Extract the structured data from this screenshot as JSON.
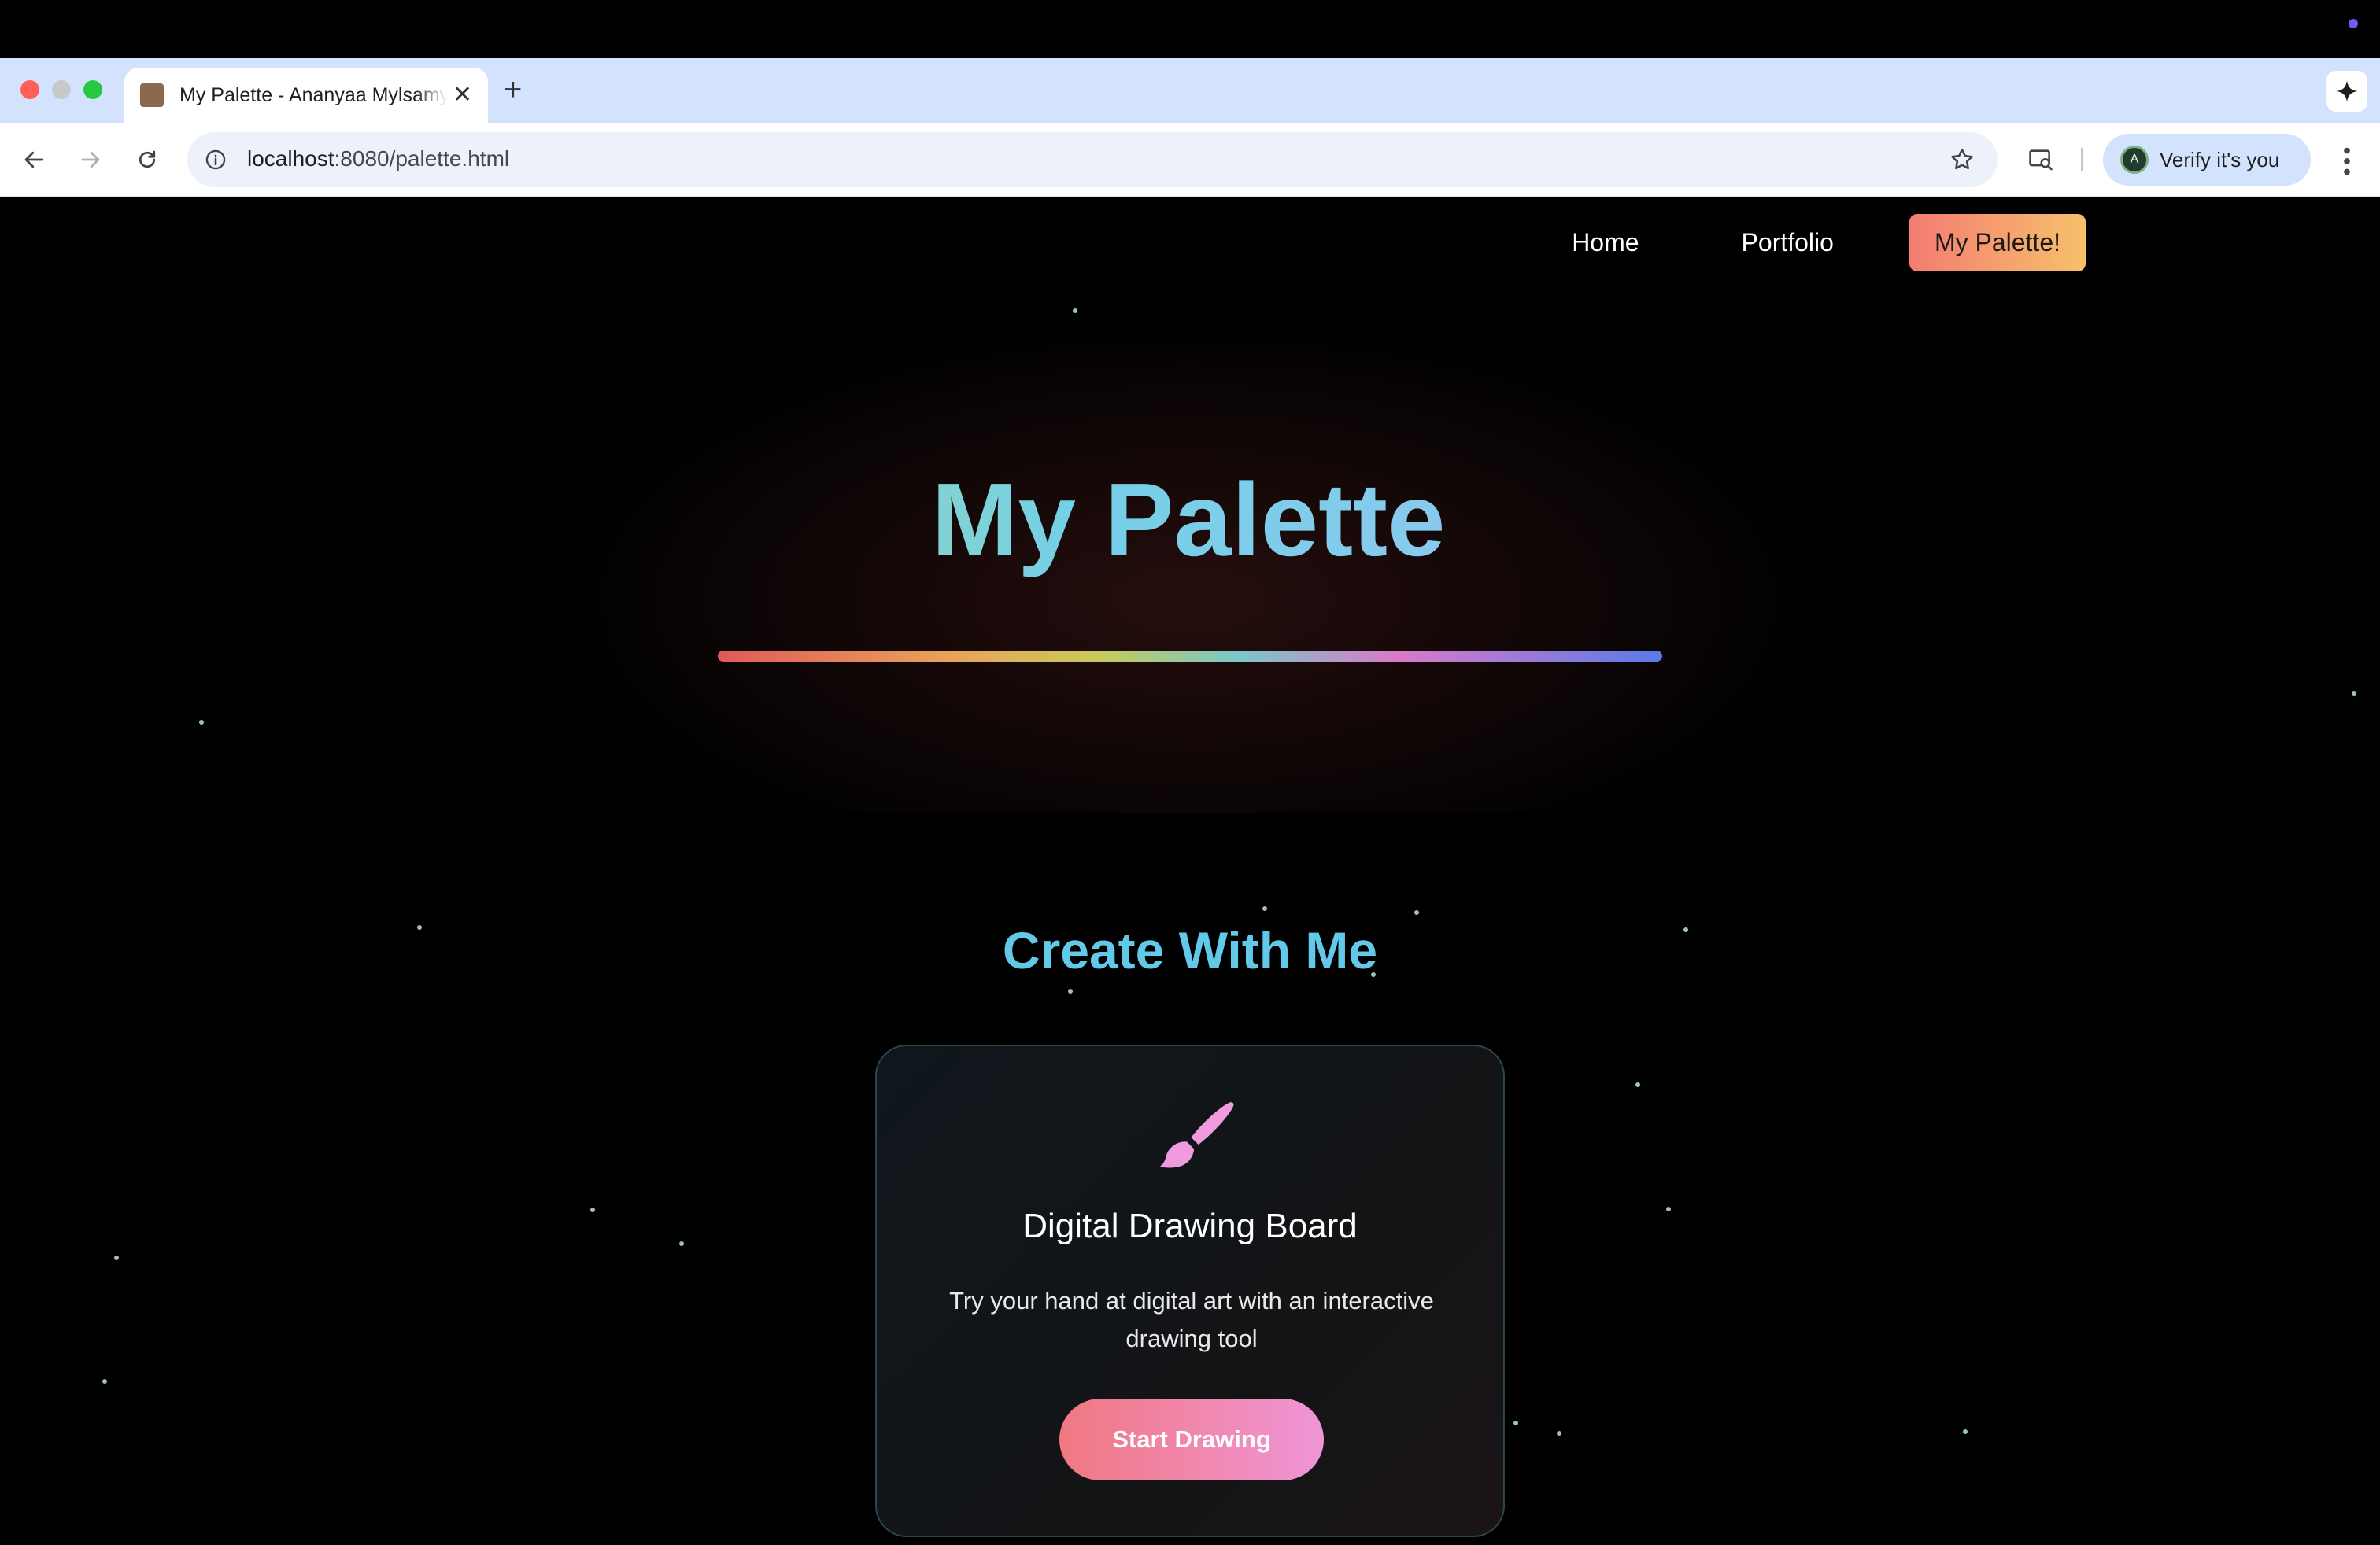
{
  "browser": {
    "tab_title": "My Palette - Ananyaa Mylsamy",
    "url_host": "localhost",
    "url_path": ":8080/palette.html",
    "profile_initial": "A",
    "profile_label": "Verify it's you"
  },
  "nav": {
    "home": "Home",
    "portfolio": "Portfolio",
    "palette": "My Palette!"
  },
  "hero": {
    "title": "My Palette"
  },
  "section": {
    "title": "Create With Me"
  },
  "card": {
    "icon": "paintbrush-icon",
    "title": "Digital Drawing Board",
    "description": "Try your hand at digital art with an interactive drawing tool",
    "button": "Start Drawing"
  },
  "colors": {
    "nav_active_start": "#f47c72",
    "nav_active_end": "#f7c06b",
    "section_title": "#63c9e8",
    "brush": "#f09be0",
    "button_start": "#f07880",
    "button_end": "#f095d8"
  }
}
